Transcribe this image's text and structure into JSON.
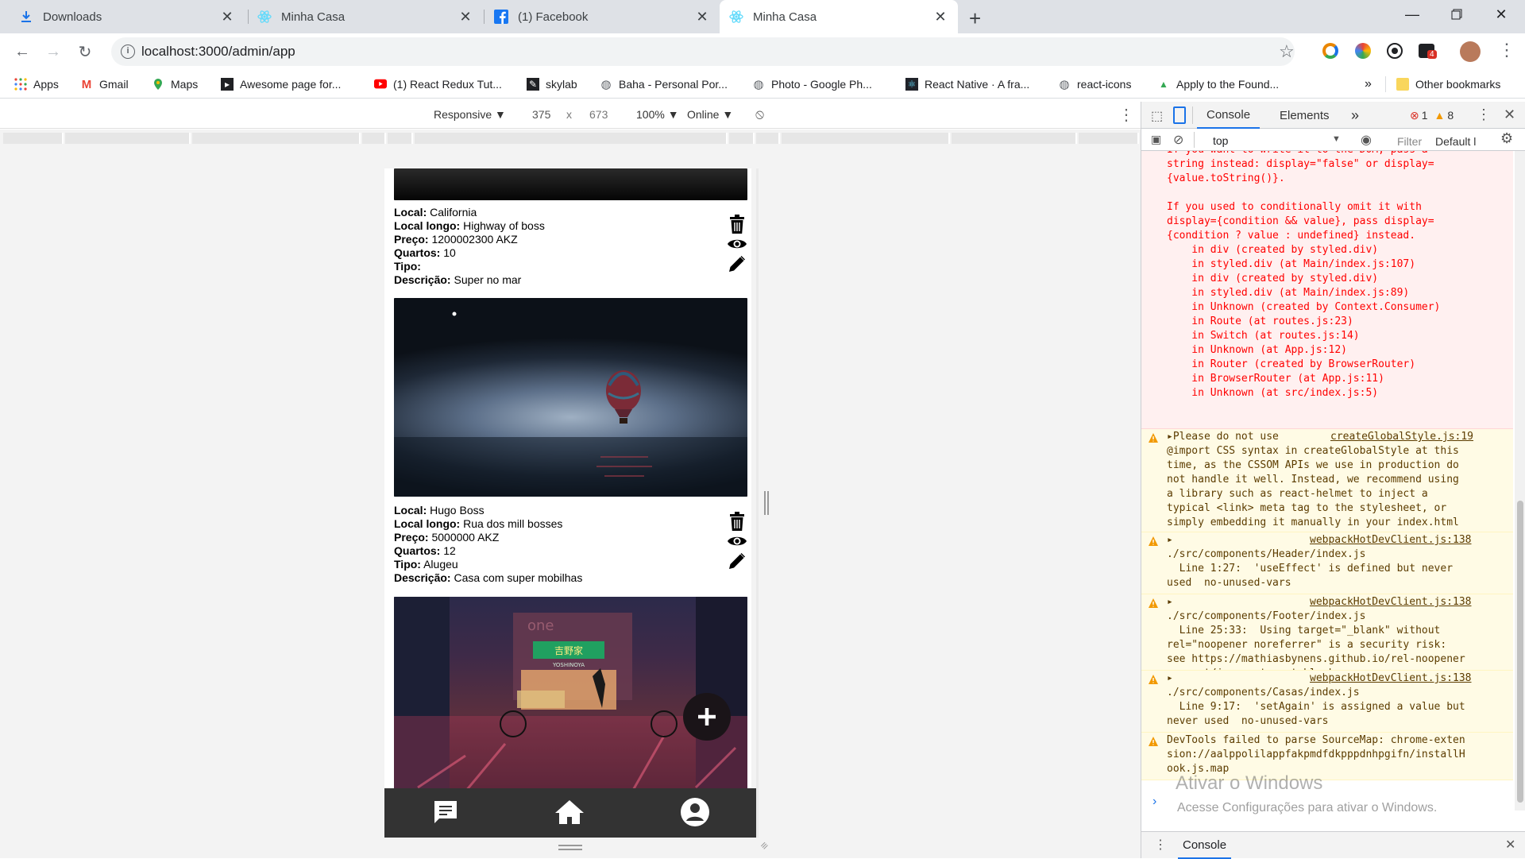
{
  "browser": {
    "tabs": [
      {
        "title": "Downloads",
        "icon": "download-icon"
      },
      {
        "title": "Minha Casa",
        "icon": "react-icon"
      },
      {
        "title": "(1) Facebook",
        "icon": "facebook-icon"
      },
      {
        "title": "Minha Casa",
        "icon": "react-icon",
        "active": true
      }
    ],
    "url": "localhost:3000/admin/app",
    "bookmarks": [
      {
        "label": "Apps",
        "icon": "apps-grid-icon"
      },
      {
        "label": "Gmail",
        "icon": "gmail-icon"
      },
      {
        "label": "Maps",
        "icon": "maps-icon"
      },
      {
        "label": "Awesome page for...",
        "icon": "bookmark-icon"
      },
      {
        "label": "(1) React Redux Tut...",
        "icon": "youtube-icon"
      },
      {
        "label": "skylab",
        "icon": "bookmark-icon"
      },
      {
        "label": "Baha - Personal Por...",
        "icon": "globe-icon"
      },
      {
        "label": "Photo - Google Ph...",
        "icon": "globe-icon"
      },
      {
        "label": "React Native · A fra...",
        "icon": "react-icon"
      },
      {
        "label": "react-icons",
        "icon": "globe-icon"
      },
      {
        "label": "Apply to the Found...",
        "icon": "bookmark-icon"
      }
    ],
    "bookmarks_more": "»",
    "other_bookmarks": "Other bookmarks",
    "extension_badge": "4"
  },
  "device_toolbar": {
    "mode": "Responsive ▼",
    "width": "375",
    "times": "x",
    "height": "673",
    "zoom": "100% ▼",
    "network": "Online ▼"
  },
  "houses": [
    {
      "local_label": "Local:",
      "local": "California",
      "local_longo_label": "Local longo:",
      "local_longo": "Highway of boss",
      "preco_label": "Preço:",
      "preco": "1200002300 AKZ",
      "quartos_label": "Quartos:",
      "quartos": "10",
      "tipo_label": "Tipo:",
      "tipo": "",
      "descricao_label": "Descrição:",
      "descricao": "Super no mar"
    },
    {
      "local_label": "Local:",
      "local": "Hugo Boss",
      "local_longo_label": "Local longo:",
      "local_longo": "Rua dos mill bosses",
      "preco_label": "Preço:",
      "preco": "5000000 AKZ",
      "quartos_label": "Quartos:",
      "quartos": "12",
      "tipo_label": "Tipo:",
      "tipo": "Alugeu",
      "descricao_label": "Descrição:",
      "descricao": "Casa com super mobilhas"
    }
  ],
  "image_signs": {
    "neon": "吉野家",
    "sign_sub": "YOSHINOYA",
    "faded": "one"
  },
  "devtools": {
    "tabs": {
      "console": "Console",
      "elements": "Elements",
      "more": "»"
    },
    "errors_count": "1",
    "warnings_count": "8",
    "context": "top",
    "filter_placeholder": "Filter",
    "levels": "Default l",
    "error_message": "If you want to write it to the DOM, pass a\nstring instead: display=\"false\" or display=\n{value.toString()}.\n\nIf you used to conditionally omit it with\ndisplay={condition && value}, pass display=\n{condition ? value : undefined} instead.\n    in div (created by styled.div)\n    in styled.div (at Main/index.js:107)\n    in div (created by styled.div)\n    in styled.div (at Main/index.js:89)\n    in Unknown (created by Context.Consumer)\n    in Route (at routes.js:23)\n    in Switch (at routes.js:14)\n    in Unknown (at App.js:12)\n    in Router (created by BrowserRouter)\n    in BrowserRouter (at App.js:11)\n    in Unknown (at src/index.js:5)",
    "warnings": [
      {
        "source": "createGlobalStyle.js:19",
        "text": "▸Please do not use\n@import CSS syntax in createGlobalStyle at this\ntime, as the CSSOM APIs we use in production do\nnot handle it well. Instead, we recommend using\na library such as react-helmet to inject a\ntypical <link> meta tag to the stylesheet, or\nsimply embedding it manually in your index.html\n<head> section for a simpler app."
      },
      {
        "source": "webpackHotDevClient.js:138",
        "text": "▸\n./src/components/Header/index.js\n  Line 1:27:  'useEffect' is defined but never\nused  no-unused-vars"
      },
      {
        "source": "webpackHotDevClient.js:138",
        "text": "▸\n./src/components/Footer/index.js\n  Line 25:33:  Using target=\"_blank\" without\nrel=\"noopener noreferrer\" is a security risk:\nsee https://mathiasbynens.github.io/rel-noopener\n  react/jsx-no-target-blank"
      },
      {
        "source": "webpackHotDevClient.js:138",
        "text": "▸\n./src/components/Casas/index.js\n  Line 9:17:  'setAgain' is assigned a value but\nnever used  no-unused-vars"
      },
      {
        "source": "",
        "text": "DevTools failed to parse SourceMap: chrome-exten\nsion://aalppolilappfakpmdfdkpppdnhpgifn/installH\nook.js.map"
      }
    ],
    "prompt": "›",
    "drawer_tab": "Console"
  },
  "watermark": {
    "line1": "Ativar o Windows",
    "line2": "Acesse Configurações para ativar o Windows."
  }
}
